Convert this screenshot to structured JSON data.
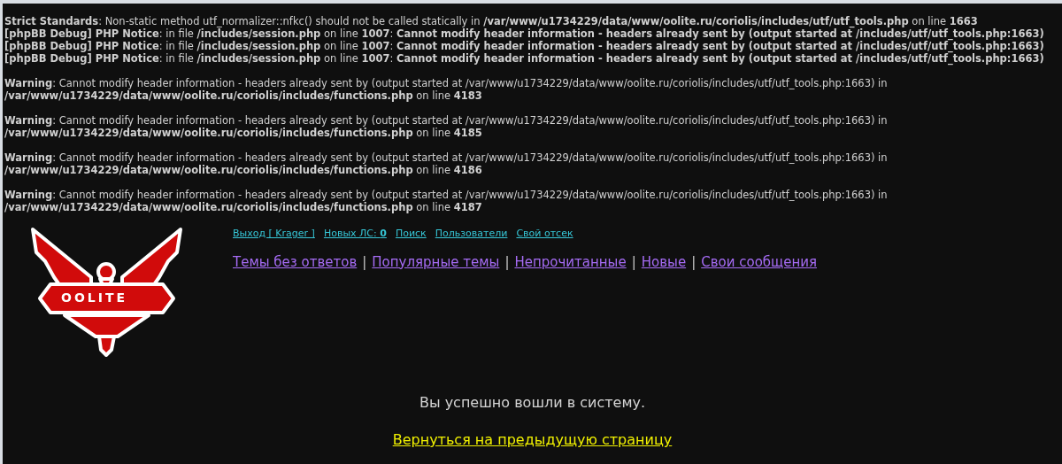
{
  "debug_messages": [
    "**Strict Standards**: Non-static method utf_normalizer::nfkc() should not be called statically in **/var/www/u1734229/data/www/oolite.ru/coriolis/includes/utf/utf_tools.php** on line **1663**",
    "**[phpBB Debug] PHP Notice**: in file **/includes/session.php** on line **1007**: **Cannot modify header information - headers already sent by (output started at /includes/utf/utf_tools.php:1663)**",
    "**[phpBB Debug] PHP Notice**: in file **/includes/session.php** on line **1007**: **Cannot modify header information - headers already sent by (output started at /includes/utf/utf_tools.php:1663)**",
    "**[phpBB Debug] PHP Notice**: in file **/includes/session.php** on line **1007**: **Cannot modify header information - headers already sent by (output started at /includes/utf/utf_tools.php:1663)**"
  ],
  "warnings": [
    "**Warning**: Cannot modify header information - headers already sent by (output started at /var/www/u1734229/data/www/oolite.ru/coriolis/includes/utf/utf_tools.php:1663) in **/var/www/u1734229/data/www/oolite.ru/coriolis/includes/functions.php** on line **4183**",
    "**Warning**: Cannot modify header information - headers already sent by (output started at /var/www/u1734229/data/www/oolite.ru/coriolis/includes/utf/utf_tools.php:1663) in **/var/www/u1734229/data/www/oolite.ru/coriolis/includes/functions.php** on line **4185**",
    "**Warning**: Cannot modify header information - headers already sent by (output started at /var/www/u1734229/data/www/oolite.ru/coriolis/includes/utf/utf_tools.php:1663) in **/var/www/u1734229/data/www/oolite.ru/coriolis/includes/functions.php** on line **4186**",
    "**Warning**: Cannot modify header information - headers already sent by (output started at /var/www/u1734229/data/www/oolite.ru/coriolis/includes/utf/utf_tools.php:1663) in **/var/www/u1734229/data/www/oolite.ru/coriolis/includes/functions.php** on line **4187**"
  ],
  "logo": {
    "text": "OOLITE"
  },
  "user_links": [
    "Выход [ Krager ]",
    "Новых ЛС: **0**",
    "Поиск",
    "Пользователи",
    "Свой отсек"
  ],
  "topic_links": [
    {
      "kind": "link",
      "text": "Темы без ответов"
    },
    {
      "kind": "separator",
      "text": "|"
    },
    {
      "kind": "link",
      "text": "Популярные темы"
    },
    {
      "kind": "separator",
      "text": "|"
    },
    {
      "kind": "link",
      "text": "Непрочитанные"
    },
    {
      "kind": "separator",
      "text": "|"
    },
    {
      "kind": "link",
      "text": "Новые"
    },
    {
      "kind": "separator",
      "text": "|"
    },
    {
      "kind": "link",
      "text": "Свои сообщения"
    }
  ],
  "message": "Вы успешно вошли в систему.",
  "return_link": "Вернуться на предыдущую страницу"
}
